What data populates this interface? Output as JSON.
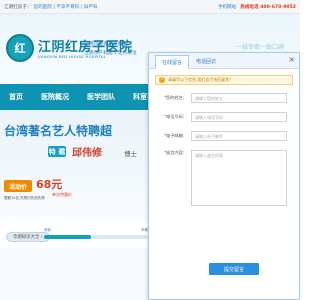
{
  "topbar": {
    "welcome": "江阴红房子：",
    "links": "您的医院 | 不孕不育科 | 妇产科",
    "mobile_label": "手机网站",
    "phone": "热线电话 400-670-9952"
  },
  "header": {
    "logo_glyph": "红",
    "hospital_name": "江阴红房子医院",
    "hospital_name_en": "JIANGYIN RED HOUSE HOSPITAL",
    "notes": [
      "江阴市医保定点单位",
      "江阴市产科建卡定点单位"
    ],
    "slogan": "一线专家一致口碑"
  },
  "nav": {
    "items": [
      "首页",
      "医院概况",
      "医学团队",
      "科室导航"
    ]
  },
  "banner": {
    "title": "台湾著名艺人特聘超",
    "badge": "特 邀",
    "doctor_name": "邱伟修",
    "doctor_title": "博士"
  },
  "promo": {
    "tag": "活动价",
    "price": "68元",
    "unit": "单次特惠价",
    "text": "限额10名,先预约先到先得"
  },
  "bottom": {
    "button": "孕期知识大全 ›",
    "progress_start": "孕前",
    "progress_end": "孕期",
    "progress_fraction": 0.45
  },
  "overlay": {
    "tabs": [
      "在线留言",
      "电话回访"
    ],
    "close_symbol": "×",
    "hint": "请填写以下信息,我们会尽快回复您!",
    "fields": {
      "name": {
        "label": "您的姓名：",
        "placeholder": "请输入您的姓名"
      },
      "phone": {
        "label": "电话号码：",
        "placeholder": "请输入电话号码"
      },
      "email": {
        "label": "电子邮箱：",
        "placeholder": "请输入电子邮件"
      },
      "message": {
        "label": "留言内容：",
        "placeholder": "请输入留言内容"
      }
    },
    "required_mark": "*",
    "submit": "提交留言"
  },
  "colors": {
    "brand": "#0f93b2",
    "accent": "#2b8fe0",
    "price": "#d6402b"
  }
}
